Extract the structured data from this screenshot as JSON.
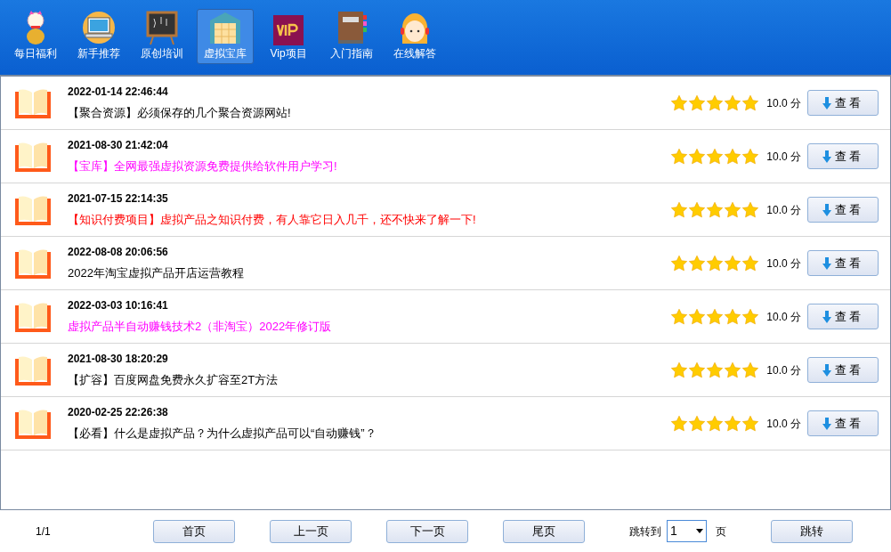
{
  "nav": [
    {
      "label": "每日福利",
      "selected": false
    },
    {
      "label": "新手推荐",
      "selected": false
    },
    {
      "label": "原创培训",
      "selected": false
    },
    {
      "label": "虚拟宝库",
      "selected": true
    },
    {
      "label": "Vip项目",
      "selected": false
    },
    {
      "label": "入门指南",
      "selected": false
    },
    {
      "label": "在线解答",
      "selected": false
    }
  ],
  "items": [
    {
      "date": "2022-01-14 22:46:44",
      "title": "【聚合资源】必须保存的几个聚合资源网站!",
      "color": "#000000",
      "stars": 5,
      "score": "10.0 分",
      "button": "查看"
    },
    {
      "date": "2021-08-30 21:42:04",
      "title": "【宝库】全网最强虚拟资源免费提供给软件用户学习!",
      "color": "#ff00ff",
      "stars": 5,
      "score": "10.0 分",
      "button": "查看"
    },
    {
      "date": "2021-07-15 22:14:35",
      "title": "【知识付费项目】虚拟产品之知识付费，有人靠它日入几千，还不快来了解一下!",
      "color": "#ff0000",
      "stars": 5,
      "score": "10.0 分",
      "button": "查看"
    },
    {
      "date": "2022-08-08 20:06:56",
      "title": "2022年淘宝虚拟产品开店运营教程",
      "color": "#000000",
      "stars": 5,
      "score": "10.0 分",
      "button": "查看"
    },
    {
      "date": "2022-03-03 10:16:41",
      "title": "虚拟产品半自动赚钱技术2（非淘宝）2022年修订版",
      "color": "#ff00ff",
      "stars": 5,
      "score": "10.0 分",
      "button": "查看"
    },
    {
      "date": "2021-08-30 18:20:29",
      "title": "【扩容】百度网盘免费永久扩容至2T方法",
      "color": "#000000",
      "stars": 5,
      "score": "10.0 分",
      "button": "查看"
    },
    {
      "date": "2020-02-25 22:26:38",
      "title": "【必看】什么是虚拟产品？为什么虚拟产品可以“自动赚钱”？",
      "color": "#000000",
      "stars": 5,
      "score": "10.0 分",
      "button": "查看"
    }
  ],
  "pager": {
    "page_info": "1/1",
    "first": "首页",
    "prev": "上一页",
    "next": "下一页",
    "last": "尾页",
    "jump_label": "跳转到",
    "page_value": "1",
    "page_unit": "页",
    "jump": "跳转"
  }
}
